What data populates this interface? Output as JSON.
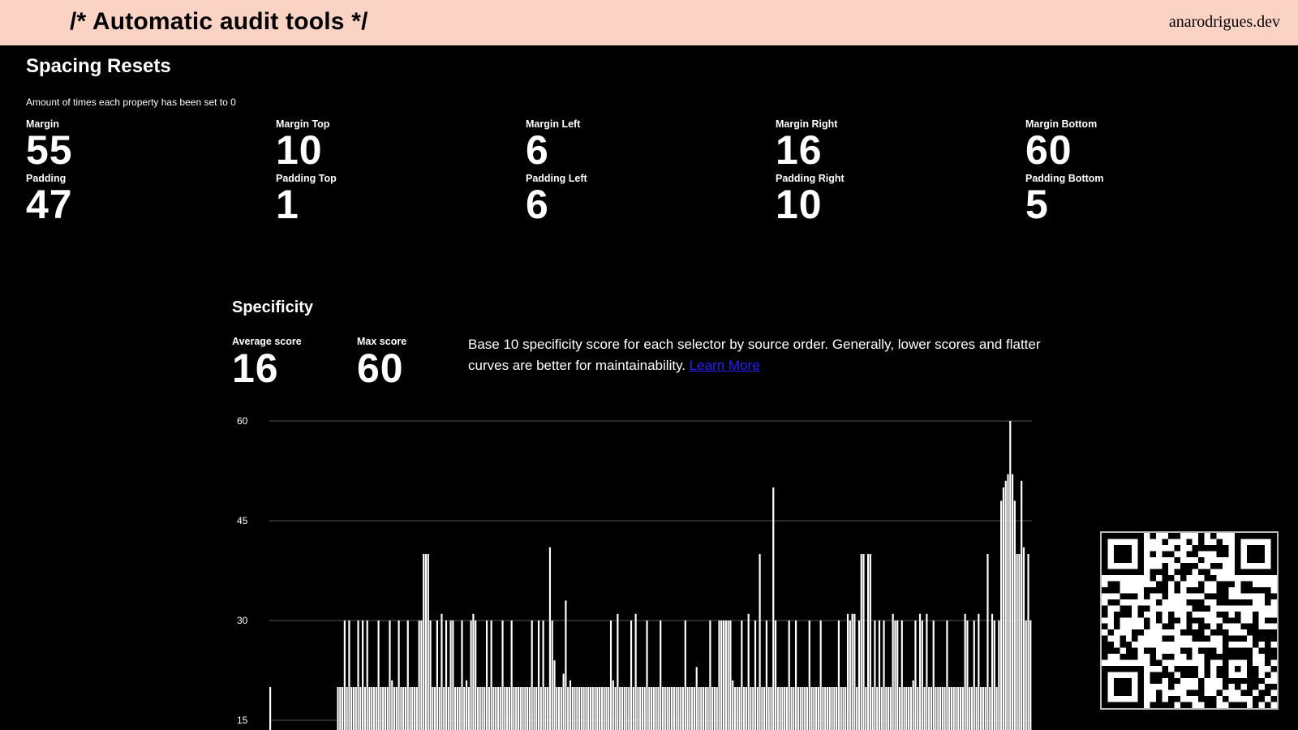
{
  "header": {
    "title": "/* Automatic audit tools */",
    "site": "anarodrigues.dev"
  },
  "spacing": {
    "title": "Spacing Resets",
    "subtitle": "Amount of times each property has been set to 0",
    "margin": [
      {
        "label": "Margin",
        "value": "55"
      },
      {
        "label": "Margin Top",
        "value": "10"
      },
      {
        "label": "Margin Left",
        "value": "6"
      },
      {
        "label": "Margin Right",
        "value": "16"
      },
      {
        "label": "Margin Bottom",
        "value": "60"
      }
    ],
    "padding": [
      {
        "label": "Padding",
        "value": "47"
      },
      {
        "label": "Padding Top",
        "value": "1"
      },
      {
        "label": "Padding Left",
        "value": "6"
      },
      {
        "label": "Padding Right",
        "value": "10"
      },
      {
        "label": "Padding Bottom",
        "value": "5"
      }
    ]
  },
  "specificity": {
    "title": "Specificity",
    "average_label": "Average score",
    "average_value": "16",
    "max_label": "Max score",
    "max_value": "60",
    "description": "Base 10 specificity score for each selector by source order. Generally, lower scores and flatter curves are better for maintainability.",
    "link_text": "Learn More"
  },
  "chart_data": {
    "type": "bar",
    "title": "",
    "xlabel": "",
    "ylabel": "",
    "ylim": [
      15,
      60
    ],
    "yticks": [
      "60",
      "45",
      "30",
      "15"
    ],
    "grid": true,
    "values": [
      20,
      12,
      11,
      11,
      11,
      11,
      11,
      11,
      11,
      11,
      11,
      11,
      11,
      11,
      11,
      11,
      11,
      11,
      11,
      11,
      11,
      11,
      11,
      11,
      11,
      11,
      11,
      11,
      11,
      11,
      20,
      20,
      20,
      30,
      20,
      30,
      20,
      20,
      20,
      30,
      20,
      30,
      20,
      30,
      20,
      20,
      20,
      20,
      30,
      20,
      20,
      20,
      20,
      30,
      21,
      20,
      20,
      30,
      20,
      20,
      20,
      30,
      20,
      20,
      20,
      20,
      30,
      30,
      40,
      40,
      40,
      30,
      20,
      20,
      30,
      20,
      31,
      20,
      30,
      20,
      30,
      30,
      20,
      20,
      20,
      30,
      20,
      21,
      20,
      30,
      31,
      30,
      20,
      20,
      20,
      20,
      30,
      20,
      30,
      20,
      20,
      20,
      20,
      30,
      20,
      20,
      20,
      30,
      20,
      20,
      20,
      20,
      20,
      20,
      20,
      20,
      30,
      20,
      20,
      30,
      20,
      30,
      20,
      20,
      41,
      30,
      24,
      20,
      20,
      20,
      22,
      33,
      20,
      21,
      20,
      20,
      20,
      20,
      20,
      20,
      20,
      20,
      20,
      20,
      20,
      20,
      20,
      20,
      20,
      20,
      20,
      30,
      21,
      20,
      31,
      20,
      20,
      20,
      20,
      20,
      30,
      20,
      31,
      20,
      20,
      20,
      20,
      30,
      20,
      20,
      20,
      20,
      20,
      30,
      20,
      20,
      20,
      20,
      20,
      20,
      20,
      20,
      20,
      20,
      30,
      20,
      20,
      20,
      20,
      23,
      20,
      20,
      20,
      20,
      20,
      30,
      20,
      20,
      20,
      30,
      30,
      30,
      30,
      30,
      30,
      21,
      20,
      20,
      20,
      30,
      20,
      20,
      31,
      20,
      20,
      30,
      20,
      40,
      20,
      20,
      30,
      20,
      20,
      50,
      30,
      20,
      20,
      20,
      20,
      20,
      30,
      20,
      20,
      30,
      20,
      20,
      20,
      20,
      20,
      30,
      20,
      20,
      20,
      20,
      30,
      20,
      20,
      20,
      20,
      20,
      20,
      20,
      30,
      20,
      20,
      20,
      31,
      30,
      31,
      31,
      20,
      30,
      40,
      40,
      20,
      40,
      40,
      20,
      30,
      20,
      30,
      20,
      30,
      20,
      20,
      20,
      31,
      30,
      30,
      20,
      30,
      20,
      20,
      20,
      20,
      21,
      30,
      20,
      31,
      30,
      20,
      31,
      20,
      20,
      30,
      20,
      20,
      20,
      20,
      20,
      30,
      20,
      20,
      20,
      20,
      20,
      20,
      20,
      31,
      30,
      20,
      20,
      30,
      20,
      31,
      20,
      20,
      20,
      40,
      20,
      31,
      30,
      20,
      30,
      48,
      50,
      51,
      52,
      60,
      52,
      48,
      40,
      40,
      51,
      41,
      30,
      40,
      30
    ]
  },
  "qr": {
    "icon": "qr-code-icon"
  }
}
